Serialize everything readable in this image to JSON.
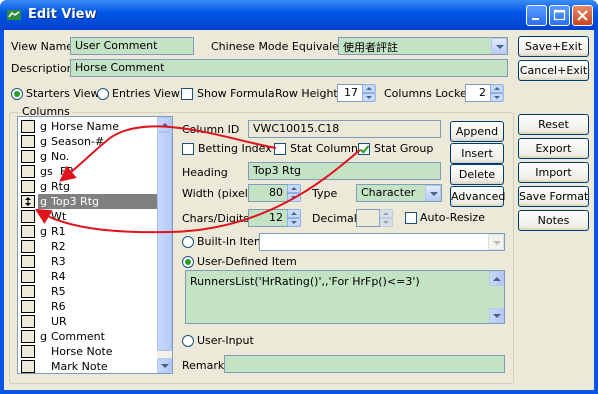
{
  "window": {
    "title": "Edit View"
  },
  "form": {
    "view_name_label": "View Name",
    "view_name_value": "User Comment",
    "chinese_mode_label": "Chinese Mode Equivalent",
    "chinese_mode_value": "使用者評註",
    "description_label": "Description",
    "description_value": "Horse Comment",
    "starters_view_label": "Starters View",
    "entries_view_label": "Entries View",
    "show_formula_label": "Show Formula",
    "row_height_label": "Row Height",
    "row_height_value": "17",
    "columns_locked_label": "Columns Locked",
    "columns_locked_value": "2",
    "columns_group_label": "Columns"
  },
  "columns_list": [
    {
      "g": "g",
      "name": "Horse Name"
    },
    {
      "g": "g",
      "name": "Season-#"
    },
    {
      "g": "g",
      "name": "No."
    },
    {
      "g": "gs",
      "name": "FP"
    },
    {
      "g": "g",
      "name": "Rtg"
    },
    {
      "g": "g",
      "name": "Top3 Rtg"
    },
    {
      "g": "",
      "name": "Wt"
    },
    {
      "g": "g",
      "name": "R1"
    },
    {
      "g": "",
      "name": "R2"
    },
    {
      "g": "",
      "name": "R3"
    },
    {
      "g": "",
      "name": "R4"
    },
    {
      "g": "",
      "name": "R5"
    },
    {
      "g": "",
      "name": "R6"
    },
    {
      "g": "",
      "name": "UR"
    },
    {
      "g": "g",
      "name": "Comment"
    },
    {
      "g": "",
      "name": "Horse Note"
    },
    {
      "g": "",
      "name": "Mark Note"
    }
  ],
  "column": {
    "column_id_label": "Column ID",
    "column_id_value": "VWC10015.C18",
    "betting_index_label": "Betting Index",
    "stat_column_label": "Stat Column",
    "stat_group_label": "Stat Group",
    "heading_label": "Heading",
    "heading_value": "Top3 Rtg",
    "width_label": "Width (pixel)",
    "width_value": "80",
    "type_label": "Type",
    "type_value": "Character",
    "chars_label": "Chars/Digits",
    "chars_value": "12",
    "decimal_label": "Decimal",
    "auto_resize_label": "Auto-Resize",
    "builtin_label": "Built-In Item",
    "user_defined_label": "User-Defined Item",
    "formula_value": "RunnersList('HrRating()',,'For HrFp()<=3')",
    "user_input_label": "User-Input",
    "remark_label": "Remark"
  },
  "buttons": {
    "append": "Append",
    "insert": "Insert",
    "delete": "Delete",
    "advanced": "Advanced",
    "save_exit": "Save+Exit",
    "cancel_exit": "Cancel+Exit",
    "reset": "Reset",
    "export": "Export",
    "import": "Import",
    "save_format": "Save Format",
    "notes": "Notes"
  },
  "colors": {
    "titlebar": "#0058e6",
    "field_green": "#c4e2c4",
    "annotation_red": "#e0141e"
  }
}
